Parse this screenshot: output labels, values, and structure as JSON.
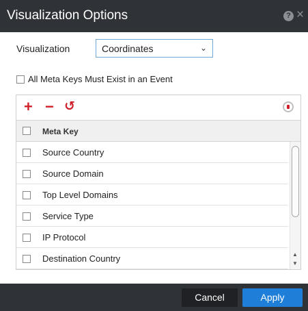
{
  "dialog": {
    "title": "Visualization Options",
    "help_icon": "question-circle-icon",
    "close_icon": "close-icon",
    "help_glyph": "?",
    "close_glyph": "×"
  },
  "visualization": {
    "label": "Visualization",
    "selected": "Coordinates"
  },
  "all_meta_keys": {
    "label": "All Meta Keys Must Exist in an Event",
    "checked": false
  },
  "toolbar": {
    "add_glyph": "+",
    "remove_glyph": "−",
    "reset_glyph": "↺",
    "info_icon": "info-icon"
  },
  "table": {
    "header": "Meta Key",
    "rows": [
      {
        "label": "Source Country",
        "checked": false
      },
      {
        "label": "Source Domain",
        "checked": false
      },
      {
        "label": "Top Level Domains",
        "checked": false
      },
      {
        "label": "Service Type",
        "checked": false
      },
      {
        "label": "IP Protocol",
        "checked": false
      },
      {
        "label": "Destination Country",
        "checked": false
      }
    ]
  },
  "footer": {
    "cancel_label": "Cancel",
    "apply_label": "Apply"
  },
  "colors": {
    "titlebar": "#2f3237",
    "accent_red": "#d0202a",
    "apply_blue": "#1f7fd8"
  }
}
